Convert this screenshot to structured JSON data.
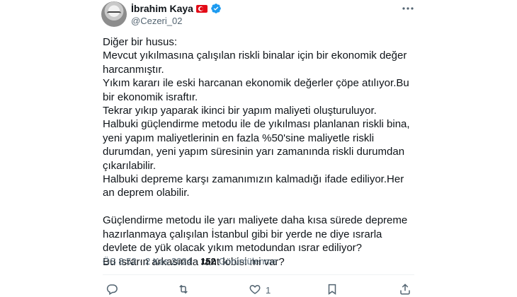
{
  "author": {
    "display_name": "İbrahim Kaya",
    "handle": "@Cezeri_02"
  },
  "icons": {
    "avatar": "profile-photo",
    "flag": "turkey-flag-icon",
    "verified": "verified-badge-icon",
    "more": "more-options-icon",
    "reply": "reply-icon",
    "retweet": "retweet-icon",
    "like": "like-icon",
    "bookmark": "bookmark-icon",
    "share": "share-icon"
  },
  "colors": {
    "verified": "#1d9bf0",
    "flag": "#e30a17",
    "secondary_text": "#536471"
  },
  "tweet": {
    "text": "Diğer bir husus:\nMevcut yıkılmasına çalışılan riskli binalar için bir ekonomik değer harcanmıştır.\nYıkım kararı ile eski harcanan ekonomik değerler çöpe atılıyor.Bu bir ekonomik israftır.\nTekrar yıkıp yaparak ikinci bir yapım maliyeti oluşturuluyor.\nHalbuki güçlendirme metodu ile de yıkılması planlanan riskli bina, yeni yapım maliyetlerinin en fazla %50'sine maliyetle riskli durumdan, yeni yapım süresinin yarı zamanında riskli durumdan çıkarılabilir.\nHalbuki depreme karşı zamanımızın kalmadığı ifade ediliyor.Her an deprem olabilir.\n\nGüçlendirme metodu ile yarı maliyete daha kısa sürede depreme hazırlanmaya çalışılan İstanbul gibi bir yerde ne diye ısrarla devlete de yük olacak yıkım metodundan ısrar ediliyor?\nBu ısrarın arkasında rant lobisi mi var?"
  },
  "meta": {
    "time": "ÖS 8:52",
    "separator": "·",
    "date": "2 Kas 2024",
    "views_count": "152",
    "views_label": "Görüntülenme"
  },
  "actions": {
    "like_count": "1"
  }
}
